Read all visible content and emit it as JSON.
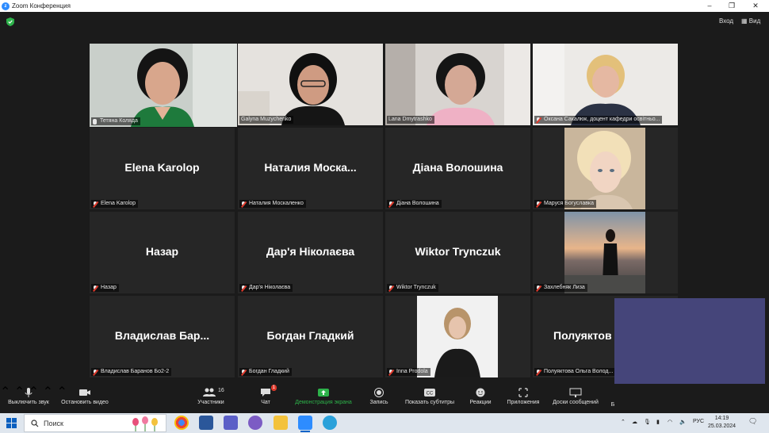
{
  "window": {
    "title": "Zoom Конференция",
    "controls": [
      "–",
      "❐",
      "✕"
    ]
  },
  "topbar": {
    "exit_label": "Вход",
    "view_label": "Вид"
  },
  "tiles": [
    {
      "id": 0,
      "name": "Тетяна Коляда",
      "video": true,
      "speaking": true,
      "muted": false
    },
    {
      "id": 1,
      "name": "Galyna Muzychenko",
      "video": true,
      "muted": false
    },
    {
      "id": 2,
      "name": "Lana Dmytrashko",
      "video": true,
      "muted": false
    },
    {
      "id": 3,
      "name": "Оксана Сакалюк, доцент кафедри освітньо...",
      "video": true,
      "muted": true
    },
    {
      "id": 4,
      "name": "Elena Karolop",
      "big": "Elena Karolop",
      "muted": true
    },
    {
      "id": 5,
      "name": "Наталия Москаленко",
      "big": "Наталия  Моска...",
      "muted": true
    },
    {
      "id": 6,
      "name": "Діана Волошина",
      "big": "Діана Волошина",
      "muted": true
    },
    {
      "id": 7,
      "name": "Маруся Богуславка",
      "video": true,
      "muted": true
    },
    {
      "id": 8,
      "name": "Назар",
      "big": "Назар",
      "muted": true
    },
    {
      "id": 9,
      "name": "Дар'я Ніколаєва",
      "big": "Дар'я Ніколаєва",
      "muted": true
    },
    {
      "id": 10,
      "name": "Wiktor Trynczuk",
      "big": "Wiktor Trynczuk",
      "muted": true
    },
    {
      "id": 11,
      "name": "Захлебняк Лиза",
      "video": true,
      "muted": true
    },
    {
      "id": 12,
      "name": "Владислав Баранов Бо2-2",
      "big": "Владислав  Бар...",
      "muted": true
    },
    {
      "id": 13,
      "name": "Богдан Гладкий",
      "big": "Богдан Гладкий",
      "muted": true
    },
    {
      "id": 14,
      "name": "Inna Prodola",
      "video": true,
      "muted": true
    },
    {
      "id": 15,
      "name": "Полуяктова Ольга Волод...",
      "big": "Полуяктов",
      "muted": true
    }
  ],
  "toolbar": {
    "mute_label": "Выключить звук",
    "video_label": "Остановить видео",
    "participants_label": "Участники",
    "participants_count": "16",
    "chat_label": "Чат",
    "chat_badge": "1",
    "share_label": "Демонстрация экрана",
    "record_label": "Запись",
    "captions_label": "Показать субтитры",
    "reactions_label": "Реакции",
    "apps_label": "Приложения",
    "whiteboards_label": "Доски сообщений",
    "more_label": "Б"
  },
  "taskbar": {
    "search_label": "Поиск",
    "lang": "РУС",
    "time": "14:19",
    "date": "25.03.2024"
  },
  "colors": {
    "speaking_outline": "#c8e26a",
    "share_green": "#2db24a",
    "self_view": "#45457a"
  }
}
